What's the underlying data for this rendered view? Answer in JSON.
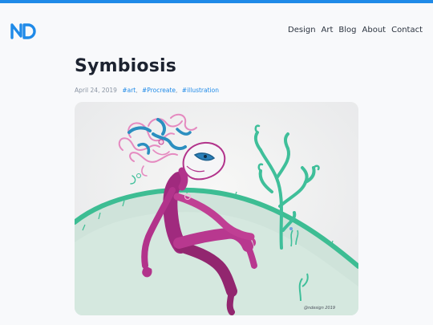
{
  "header": {
    "logo": "ND",
    "accent_color": "#1f8ae8",
    "nav": [
      {
        "label": "Design"
      },
      {
        "label": "Art"
      },
      {
        "label": "Blog"
      },
      {
        "label": "About"
      },
      {
        "label": "Contact"
      }
    ]
  },
  "post": {
    "title": "Symbiosis",
    "date": "April 24, 2019",
    "tags": [
      "#art",
      "#Procreate",
      "#illustration"
    ],
    "image": {
      "signature": "@ndesign 2019"
    }
  }
}
